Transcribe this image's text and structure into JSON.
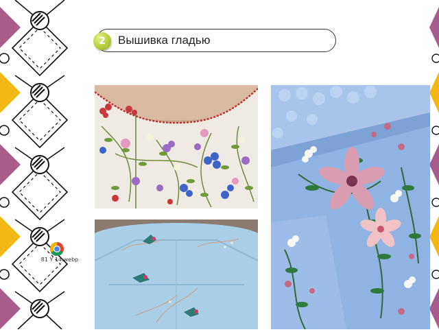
{
  "slide": {
    "number": "2",
    "title": "Вышивка гладью"
  },
  "file_icon": {
    "icon": "chrome-icon",
    "label": "81 Y 14.webp"
  },
  "decor": {
    "purple": "#a85c8c",
    "yellow": "#f3b816",
    "badge_color": "#b7cf3b"
  }
}
